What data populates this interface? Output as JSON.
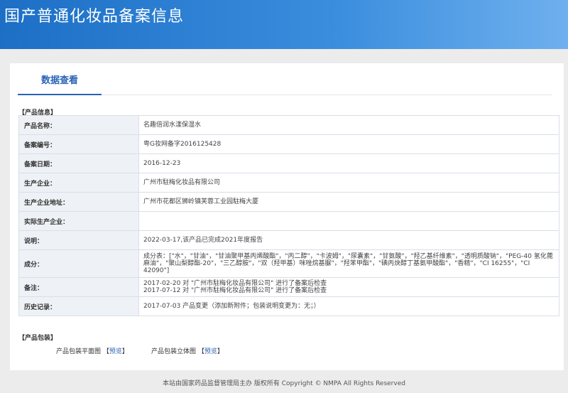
{
  "header": {
    "title": "国产普通化妆品备案信息"
  },
  "tabs": [
    {
      "label": "数据查看"
    }
  ],
  "product_section": {
    "title": "【产品信息】"
  },
  "rows": [
    {
      "label": "产品名称：",
      "value": "名趣倍润水漾保湿水"
    },
    {
      "label": "备案编号：",
      "value": "粤G妆网备字2016125428"
    },
    {
      "label": "备案日期：",
      "value": "2016-12-23"
    },
    {
      "label": "生产企业：",
      "value": "广州市駐梅化妆品有限公司"
    },
    {
      "label": "生产企业地址：",
      "value": "广州市花都区狮岭镇芙蓉工业园駐梅大厦"
    },
    {
      "label": "实际生产企业：",
      "value": ""
    },
    {
      "label": "说明：",
      "value": "2022-03-17,该产品已完成2021年度报告"
    },
    {
      "label": "成分：",
      "value": "成分表：[\"水\"，\"甘油\"，\"甘油聚甲基丙烯酸酯\"，\"丙二醇\"，\"卡波姆\"，\"尿囊素\"，\"甘氨酸\"，\"羟乙基纤维素\"，\"透明质酸钠\"，\"PEG-40 氢化蓖麻油\"，\"聚山梨醇酯-20\"，\"三乙醇胺\"，\"双（羟甲基）咪唑烷基脲\"，\"羟苯甲酯\"，\"碘丙炔醇丁基氨甲酸酯\"，\"香精\"，\"CI 16255\"，\"CI 42090\"]"
    },
    {
      "label": "备注：",
      "value_lines": [
        "2017-02-20 对 \"广州市駐梅化妆品有限公司\" 进行了备案后检查",
        "2017-07-12 对 \"广州市駐梅化妆品有限公司\" 进行了备案后检查"
      ]
    },
    {
      "label": "历史记录：",
      "value": "2017-07-03 产品变更（添加新附件；包装说明变更为：无；）"
    }
  ],
  "package_section": {
    "title": "【产品包装】",
    "flat_label": "产品包装平面图",
    "flat_link": "预览",
    "solid_label": "产品包装立体图",
    "solid_link": "预览",
    "bracket_open": "【",
    "bracket_close": "】"
  },
  "footer": {
    "text": "本站由国家药品监督管理局主办 版权所有 Copyright © NMPA All Rights Reserved"
  }
}
